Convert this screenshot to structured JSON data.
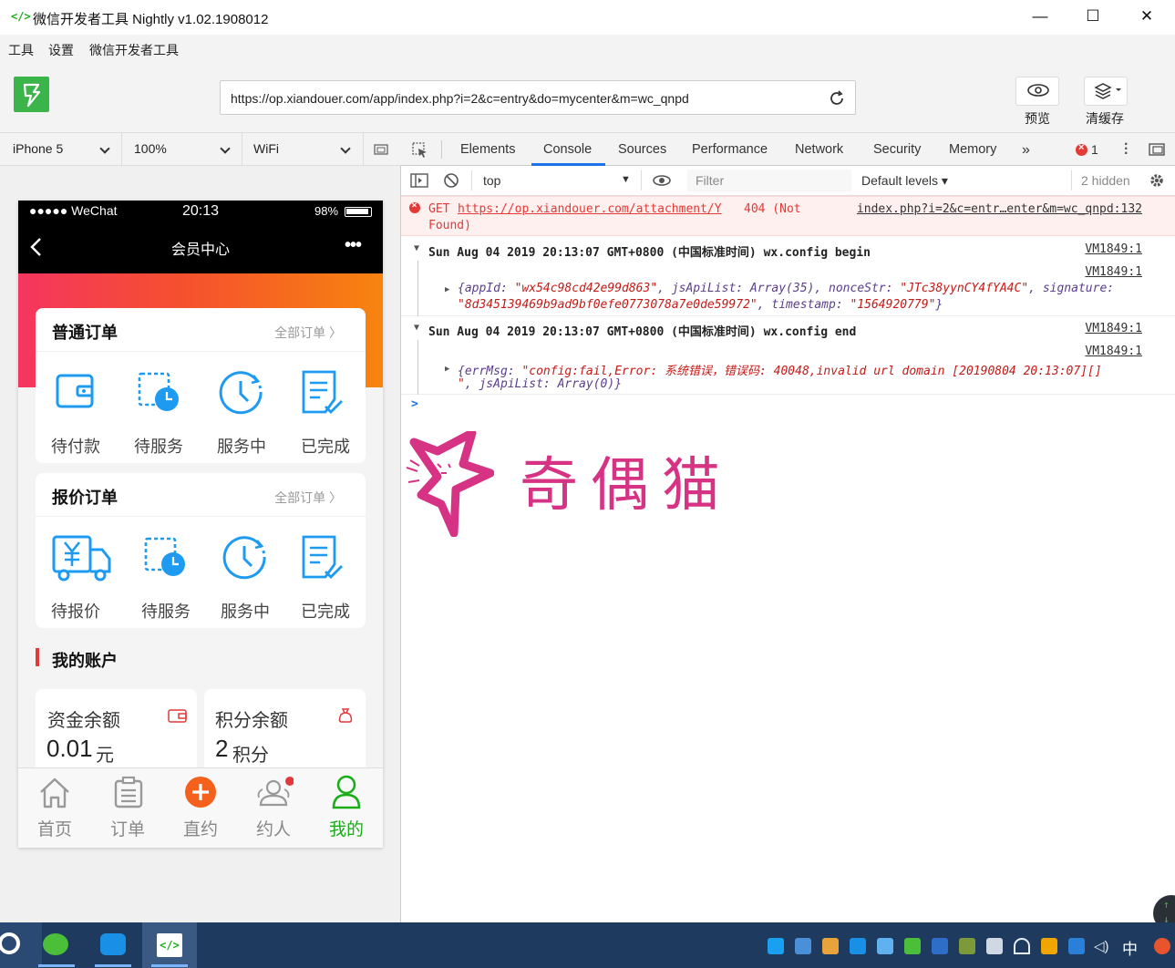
{
  "window": {
    "title": "微信开发者工具 Nightly v1.02.1908012",
    "logo_glyph": "</>",
    "minimize": "—",
    "maximize": "☐",
    "close": "✕"
  },
  "menu": [
    "工具",
    "设置",
    "微信开发者工具"
  ],
  "toolbar": {
    "url": "https://op.xiandouer.com/app/index.php?i=2&c=entry&do=mycenter&m=wc_qnpd",
    "preview_label": "预览",
    "clear_cache_label": "清缓存"
  },
  "simulator": {
    "device": "iPhone 5",
    "zoom": "100%",
    "network": "WiFi"
  },
  "phone": {
    "statusbar": {
      "carrier": "●●●●● WeChat",
      "time": "20:13",
      "battery": "98%"
    },
    "nav_title": "会员中心",
    "nav_more": "•••",
    "orders": {
      "title": "普通订单",
      "more": "全部订单 〉",
      "items": [
        "待付款",
        "待服务",
        "服务中",
        "已完成"
      ]
    },
    "quotes": {
      "title": "报价订单",
      "more": "全部订单 〉",
      "items": [
        "待报价",
        "待服务",
        "服务中",
        "已完成"
      ]
    },
    "account": {
      "title": "我的账户",
      "balance_label": "资金余额",
      "balance_value": "0.01",
      "balance_unit": "元",
      "points_label": "积分余额",
      "points_value": "2",
      "points_unit": "积分"
    },
    "tabs": [
      "首页",
      "订单",
      "直约",
      "约人",
      "我的"
    ],
    "colors": {
      "accent_blue": "#1e9bf0",
      "tab_active": "#1aad19",
      "orange": "#f5601c"
    }
  },
  "devtools": {
    "tabs": [
      "Elements",
      "Console",
      "Sources",
      "Performance",
      "Network",
      "Security",
      "Memory"
    ],
    "active_tab": "Console",
    "more_tabs": "»",
    "error_count": "1",
    "context": "top",
    "filter_placeholder": "Filter",
    "levels": "Default levels ▾",
    "hidden": "2 hidden",
    "prompt": ">"
  },
  "console": {
    "error": {
      "prefix": "GET",
      "url": "https://op.xiandouer.com/attachment/Y",
      "status": "404 (Not",
      "status2": "Found)",
      "source": "index.php?i=2&c=entr…enter&m=wc_qnpd:132"
    },
    "group1": {
      "header": "Sun Aug 04 2019 20:13:07 GMT+0800 (中国标准时间) wx.config begin",
      "source": "VM1849:1",
      "inner_source": "VM1849:1",
      "line1_key1": "{appId:",
      "line1_val1": "\"wx54c98cd42e99d863\"",
      "line1_key2": ", jsApiList: Array(35), nonceStr:",
      "line1_val2": "\"JTc38yynCY4fYA4C\"",
      "line1_key3": ", signature:",
      "line2_val": "\"8d345139469b9ad9bf0efe0773078a7e0de59972\"",
      "line2_key": ", timestamp:",
      "line2_val2": "\"1564920779\"",
      "line2_end": "}"
    },
    "group2": {
      "header": "Sun Aug 04 2019 20:13:07 GMT+0800 (中国标准时间) wx.config end",
      "source": "VM1849:1",
      "inner_source": "VM1849:1",
      "line1_key": "{errMsg:",
      "line1_val": "\"config:fail,Error: 系统错误，错误码: 40048,invalid url domain [20190804 20:13:07][]",
      "line2_val": "\"",
      "line2_rest": ", jsApiList: Array(0)}"
    }
  },
  "watermark": {
    "text": "奇偶猫",
    "color": "#d63384"
  },
  "taskbar": {
    "ime": "中"
  }
}
